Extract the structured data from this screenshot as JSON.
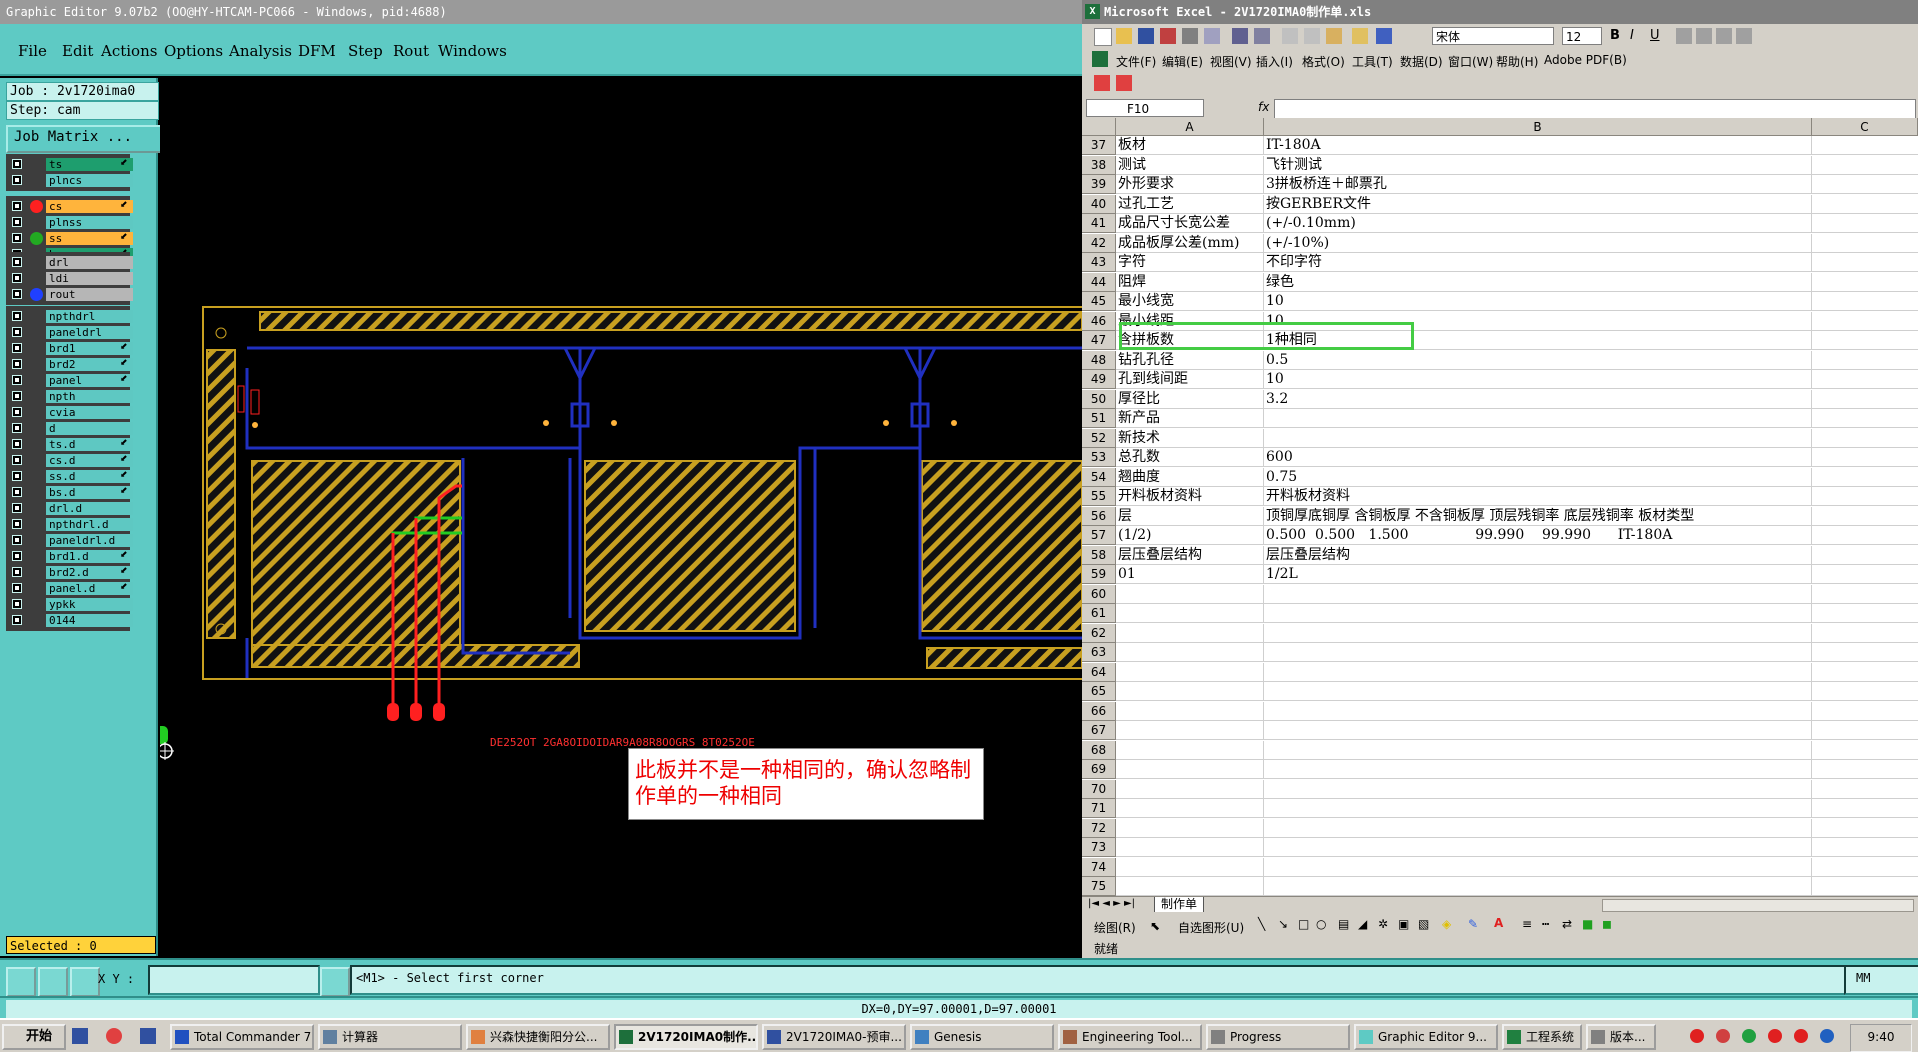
{
  "ge": {
    "title": "Graphic Editor 9.07b2 (OO@HY-HTCAM-PC066 - Windows, pid:4688)",
    "menu": [
      "File",
      "Edit",
      "Actions",
      "Options",
      "Analysis",
      "DFM",
      "Step",
      "Rout",
      "Windows"
    ],
    "job": "Job : 2v1720ima0",
    "step": "Step: cam",
    "job_matrix": "Job Matrix ...",
    "layers": [
      {
        "name": "ts",
        "color": "#1e9e6e",
        "dot": "",
        "arrow": true
      },
      {
        "name": "plncs",
        "color": "#5ec8c2",
        "dot": "",
        "arrow": false
      },
      {
        "name": "cs",
        "color": "#ffb43c",
        "dot": "#ff2020",
        "arrow": true
      },
      {
        "name": "plnss",
        "color": "#5ec8c2",
        "dot": "",
        "arrow": false
      },
      {
        "name": "ss",
        "color": "#ffb43c",
        "dot": "#22aa22",
        "arrow": true
      },
      {
        "name": "bs",
        "color": "#1e9e6e",
        "dot": "",
        "arrow": true
      },
      {
        "name": "drl",
        "color": "#b6b6b6",
        "dot": "",
        "arrow": false
      },
      {
        "name": "ldi",
        "color": "#b6b6b6",
        "dot": "",
        "arrow": false
      },
      {
        "name": "rout",
        "color": "#b6b6b6",
        "dot": "#2040ff",
        "arrow": false
      },
      {
        "name": "npthdrl",
        "color": "#5ec8c2",
        "dot": "",
        "arrow": false
      },
      {
        "name": "paneldrl",
        "color": "#5ec8c2",
        "dot": "",
        "arrow": false
      },
      {
        "name": "brd1",
        "color": "#5ec8c2",
        "dot": "",
        "arrow": true
      },
      {
        "name": "brd2",
        "color": "#5ec8c2",
        "dot": "",
        "arrow": true
      },
      {
        "name": "panel",
        "color": "#5ec8c2",
        "dot": "",
        "arrow": true
      },
      {
        "name": "npth",
        "color": "#5ec8c2",
        "dot": "",
        "arrow": false
      },
      {
        "name": "cvia",
        "color": "#5ec8c2",
        "dot": "",
        "arrow": false
      },
      {
        "name": "d",
        "color": "#5ec8c2",
        "dot": "",
        "arrow": false
      },
      {
        "name": "ts.d",
        "color": "#5ec8c2",
        "dot": "",
        "arrow": true
      },
      {
        "name": "cs.d",
        "color": "#5ec8c2",
        "dot": "",
        "arrow": true
      },
      {
        "name": "ss.d",
        "color": "#5ec8c2",
        "dot": "",
        "arrow": true
      },
      {
        "name": "bs.d",
        "color": "#5ec8c2",
        "dot": "",
        "arrow": true
      },
      {
        "name": "drl.d",
        "color": "#5ec8c2",
        "dot": "",
        "arrow": false
      },
      {
        "name": "npthdrl.d",
        "color": "#5ec8c2",
        "dot": "",
        "arrow": false
      },
      {
        "name": "paneldrl.d",
        "color": "#5ec8c2",
        "dot": "",
        "arrow": false
      },
      {
        "name": "brd1.d",
        "color": "#5ec8c2",
        "dot": "",
        "arrow": true
      },
      {
        "name": "brd2.d",
        "color": "#5ec8c2",
        "dot": "",
        "arrow": true
      },
      {
        "name": "panel.d",
        "color": "#5ec8c2",
        "dot": "",
        "arrow": true
      },
      {
        "name": "ypkk",
        "color": "#5ec8c2",
        "dot": "",
        "arrow": false
      },
      {
        "name": "0144",
        "color": "#5ec8c2",
        "dot": "",
        "arrow": false
      }
    ],
    "selected": "Selected : 0",
    "xy_label": "X Y :",
    "xy_value": "",
    "prompt": "<M1> - Select first corner",
    "units": "MM",
    "dxdy": "DX=0,DY=97.00001,D=97.00001",
    "board_text": "DE252OT 2GA8OIDOIDAR9A08R8OOGRS 8T0252OE",
    "note": "此板并不是一种相同的，确认忽略制作单的一种相同"
  },
  "xl": {
    "title": "Microsoft Excel - 2V1720IMA0制作单.xls",
    "font": "宋体",
    "font_size": "12",
    "menu": [
      "文件(F)",
      "编辑(E)",
      "视图(V)",
      "插入(I)",
      "格式(O)",
      "工具(T)",
      "数据(D)",
      "窗口(W)",
      "帮助(H)",
      "Adobe PDF(B)"
    ],
    "name_box": "F10",
    "fx": "fx",
    "cols": [
      "A",
      "B",
      "C"
    ],
    "rows": [
      {
        "n": "37",
        "a": "板材",
        "b": "IT-180A"
      },
      {
        "n": "38",
        "a": "测试",
        "b": "飞针测试"
      },
      {
        "n": "39",
        "a": "外形要求",
        "b": "3拼板桥连＋邮票孔"
      },
      {
        "n": "40",
        "a": "过孔工艺",
        "b": "按GERBER文件"
      },
      {
        "n": "41",
        "a": "成品尺寸长宽公差",
        "b": "(+/-0.10mm)"
      },
      {
        "n": "42",
        "a": "成品板厚公差(mm)",
        "b": "(+/-10%)"
      },
      {
        "n": "43",
        "a": "字符",
        "b": "不印字符"
      },
      {
        "n": "44",
        "a": "阻焊",
        "b": "绿色"
      },
      {
        "n": "45",
        "a": "最小线宽",
        "b": "10"
      },
      {
        "n": "46",
        "a": "最小线距",
        "b": "10"
      },
      {
        "n": "47",
        "a": "含拼板数",
        "b": "1种相同"
      },
      {
        "n": "48",
        "a": "钻孔孔径",
        "b": "0.5"
      },
      {
        "n": "49",
        "a": "孔到线间距",
        "b": "10"
      },
      {
        "n": "50",
        "a": "厚径比",
        "b": "3.2"
      },
      {
        "n": "51",
        "a": "新产品",
        "b": ""
      },
      {
        "n": "52",
        "a": "新技术",
        "b": ""
      },
      {
        "n": "53",
        "a": "总孔数",
        "b": "600"
      },
      {
        "n": "54",
        "a": "翘曲度",
        "b": "0.75"
      },
      {
        "n": "55",
        "a": "开料板材资料",
        "b": "开料板材资料"
      },
      {
        "n": "56",
        "a": "层",
        "b": "顶铜厚底铜厚 含铜板厚 不含铜板厚 顶层残铜率 底层残铜率 板材类型"
      },
      {
        "n": "57",
        "a": "(1/2)",
        "b": "0.500  0.500   1.500               99.990    99.990      IT-180A"
      },
      {
        "n": "58",
        "a": "层压叠层结构",
        "b": "层压叠层结构"
      },
      {
        "n": "59",
        "a": "01",
        "b": "1/2L"
      },
      {
        "n": "60",
        "a": "",
        "b": ""
      },
      {
        "n": "61",
        "a": "",
        "b": ""
      },
      {
        "n": "62",
        "a": "",
        "b": ""
      },
      {
        "n": "63",
        "a": "",
        "b": ""
      },
      {
        "n": "64",
        "a": "",
        "b": ""
      },
      {
        "n": "65",
        "a": "",
        "b": ""
      },
      {
        "n": "66",
        "a": "",
        "b": ""
      },
      {
        "n": "67",
        "a": "",
        "b": ""
      },
      {
        "n": "68",
        "a": "",
        "b": ""
      },
      {
        "n": "69",
        "a": "",
        "b": ""
      },
      {
        "n": "70",
        "a": "",
        "b": ""
      },
      {
        "n": "71",
        "a": "",
        "b": ""
      },
      {
        "n": "72",
        "a": "",
        "b": ""
      },
      {
        "n": "73",
        "a": "",
        "b": ""
      },
      {
        "n": "74",
        "a": "",
        "b": ""
      },
      {
        "n": "75",
        "a": "",
        "b": ""
      },
      {
        "n": "76",
        "a": "",
        "b": ""
      }
    ],
    "sheet_tab": "制作单",
    "draw_label": "绘图(R)",
    "autoshape_label": "自选图形(U)",
    "status": "就绪"
  },
  "taskbar": {
    "start": "开始",
    "items": [
      {
        "label": "Total Commander 7...",
        "active": false
      },
      {
        "label": "计算器",
        "active": false
      },
      {
        "label": "兴森快捷衡阳分公...",
        "active": false
      },
      {
        "label": "2V1720IMA0制作...",
        "active": true
      },
      {
        "label": "2V1720IMA0-预审...",
        "active": false
      },
      {
        "label": "Genesis",
        "active": false
      },
      {
        "label": "Engineering Tool...",
        "active": false
      },
      {
        "label": "Progress",
        "active": false
      },
      {
        "label": "Graphic Editor 9...",
        "active": false
      },
      {
        "label": "工程系统",
        "active": false
      },
      {
        "label": "版本...",
        "active": false
      }
    ],
    "clock": "9:40"
  }
}
